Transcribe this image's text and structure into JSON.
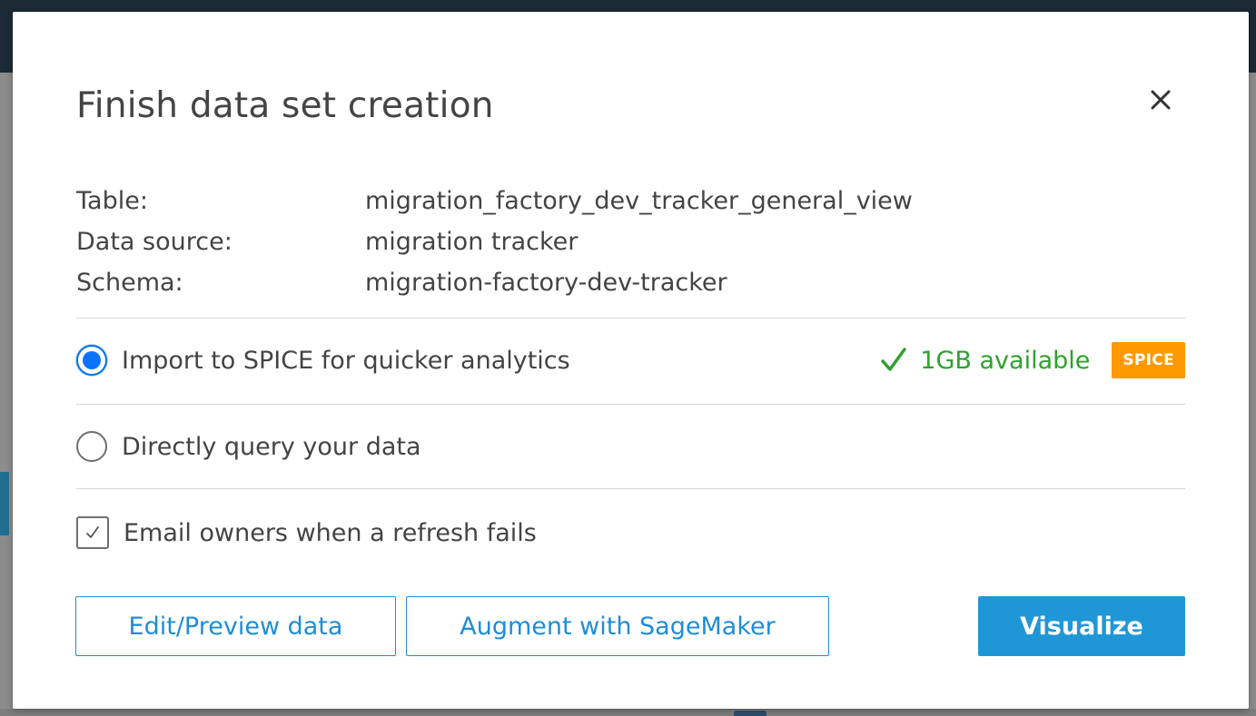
{
  "dialog": {
    "title": "Finish data set creation",
    "close_icon": "close-icon"
  },
  "info": [
    {
      "label": "Table:",
      "value": "migration_factory_dev_tracker_general_view"
    },
    {
      "label": "Data source:",
      "value": "migration tracker"
    },
    {
      "label": "Schema:",
      "value": "migration-factory-dev-tracker"
    }
  ],
  "options": {
    "spice": {
      "label": "Import to SPICE for quicker analytics",
      "selected": true,
      "capacity_icon": "check-icon",
      "capacity_text": "1GB available",
      "badge": "SPICE"
    },
    "direct": {
      "label": "Directly query your data",
      "selected": false
    }
  },
  "email_owners": {
    "label": "Email owners when a refresh fails",
    "checked": true
  },
  "buttons": {
    "edit_preview": "Edit/Preview data",
    "augment": "Augment with SageMaker",
    "visualize": "Visualize"
  },
  "colors": {
    "accent_blue": "#1f97d7",
    "radio_blue": "#0a72ff",
    "success_green": "#2fa12f",
    "spice_orange": "#ff9900",
    "text": "#444444"
  }
}
